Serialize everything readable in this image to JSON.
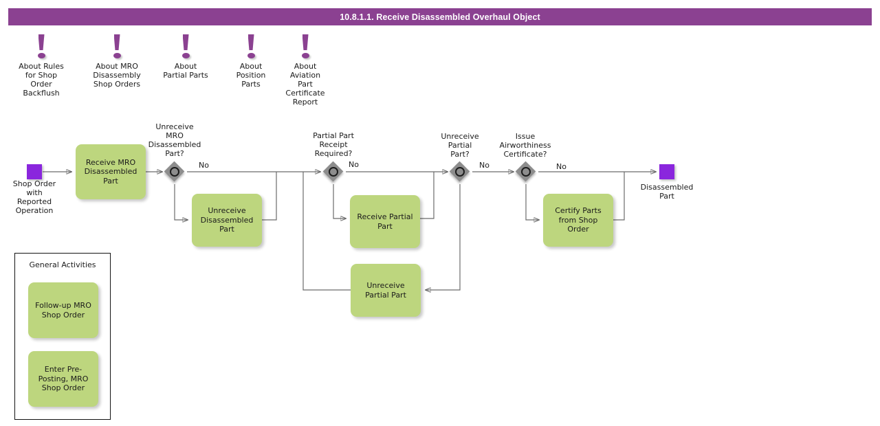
{
  "header": {
    "title": "10.8.1.1. Receive Disassembled Overhaul Object",
    "bar_color": "#8b4191",
    "text_color": "#ffffff"
  },
  "theme": {
    "task_fill": "#bdd67e",
    "event_fill": "#8a26dd",
    "gateway_fill": "#8d8d8d",
    "connector": "#6b6b6b",
    "note_accent": "#8b4191"
  },
  "notes": [
    {
      "label": "About Rules\nfor Shop\nOrder\nBackflush",
      "icon": "exclamation-note-icon"
    },
    {
      "label": "About MRO\nDisassembly\nShop Orders",
      "icon": "exclamation-note-icon"
    },
    {
      "label": "About\nPartial Parts",
      "icon": "exclamation-note-icon"
    },
    {
      "label": "About\nPosition\nParts",
      "icon": "exclamation-note-icon"
    },
    {
      "label": "About\nAviation\nPart\nCertificate\nReport",
      "icon": "exclamation-note-icon"
    }
  ],
  "events": {
    "start": {
      "label": "Shop Order\nwith\nReported\nOperation"
    },
    "end": {
      "label": "Disassembled\nPart"
    }
  },
  "tasks": [
    {
      "label": "Receive MRO\nDisassembled\nPart"
    },
    {
      "label": "Unreceive\nDisassembled\nPart"
    },
    {
      "label": "Receive Partial\nPart"
    },
    {
      "label": "Unreceive\nPartial Part"
    },
    {
      "label": "Certify Parts\nfrom Shop\nOrder"
    }
  ],
  "gateways": [
    {
      "label": "Unreceive\nMRO\nDisassembled\nPart?"
    },
    {
      "label": "Partial Part\nReceipt\nRequired?"
    },
    {
      "label": "Unreceive\nPartial\nPart?"
    },
    {
      "label": "Issue\nAirworthiness\nCertificate?"
    }
  ],
  "flow_labels": [
    {
      "text": "No"
    },
    {
      "text": "No"
    },
    {
      "text": "No"
    },
    {
      "text": "No"
    }
  ],
  "group": {
    "title": "General Activities",
    "tasks": [
      {
        "label": "Follow-up MRO\nShop Order"
      },
      {
        "label": "Enter Pre-\nPosting, MRO\nShop Order"
      }
    ]
  }
}
